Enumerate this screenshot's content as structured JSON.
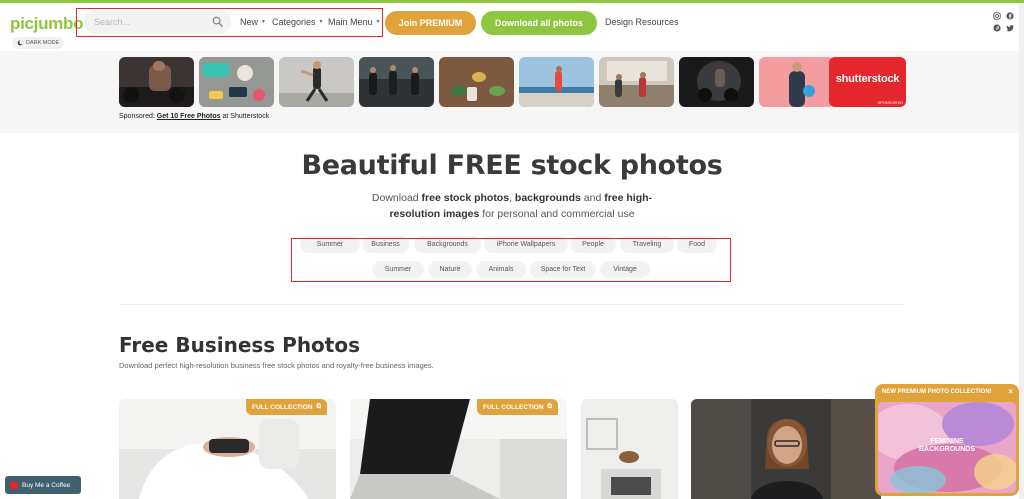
{
  "app": {
    "logo": "picjumbo",
    "dark_mode_label": "DARK MODE"
  },
  "search": {
    "placeholder": "Search...",
    "value": ""
  },
  "nav": {
    "new": "New",
    "categories": "Categories",
    "main_menu": "Main Menu",
    "join": "Join PREMIUM",
    "download": "Download all photos",
    "design": "Design Resources"
  },
  "social_icons": [
    "instagram-icon",
    "facebook-icon",
    "pinterest-icon",
    "twitter-icon"
  ],
  "sponsored": {
    "prefix": "Sponsored:",
    "link": "Get 10 Free Photos",
    "suffix": "at Shutterstock",
    "brand": "shutterstock",
    "brand_tag": "SPONSORED"
  },
  "hero": {
    "title": "Beautiful FREE stock photos",
    "sub_parts": [
      "Download ",
      "free stock photos",
      ", ",
      "backgrounds",
      " and ",
      "free high-resolution images",
      " for personal and commercial use"
    ]
  },
  "tags_row1": [
    "Summer",
    "Business",
    "Backgrounds",
    "iPhone Wallpapers",
    "People",
    "Traveling",
    "Food"
  ],
  "tags_row2": [
    "Summer",
    "Nature",
    "Animals",
    "Space for Text",
    "Vintage"
  ],
  "section": {
    "title": "Free Business Photos",
    "subtitle": "Download perfect high-resolution business free stock photos and royalty-free business images."
  },
  "badges": [
    "FULL COLLECTION",
    "FULL COLLECTION"
  ],
  "popup": {
    "title": "NEW PREMIUM PHOTO COLLECTION!",
    "close": "×",
    "art_text": "FEMININE\nBACKGROUNDS"
  },
  "coffee": {
    "label": "Buy Me a Coffee"
  },
  "colors": {
    "brand_green": "#8dc63f",
    "premium_orange": "#e0a23a",
    "highlight_red": "#e5262d",
    "shutterstock_red": "#e5262d"
  }
}
